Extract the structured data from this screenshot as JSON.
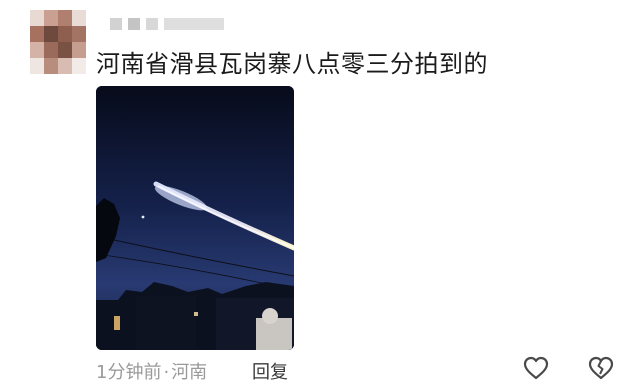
{
  "comment": {
    "text": "河南省滑县瓦岗寨八点零三分拍到的",
    "time": "1分钟前",
    "separator": "·",
    "location": "河南",
    "reply_label": "回复"
  },
  "icons": {
    "avatar": "blurred-avatar",
    "like": "heart-outline-icon",
    "dislike": "broken-heart-icon"
  },
  "colors": {
    "text": "#1b1b1b",
    "meta": "#9a9a9a",
    "icon": "#4a4a4a"
  }
}
